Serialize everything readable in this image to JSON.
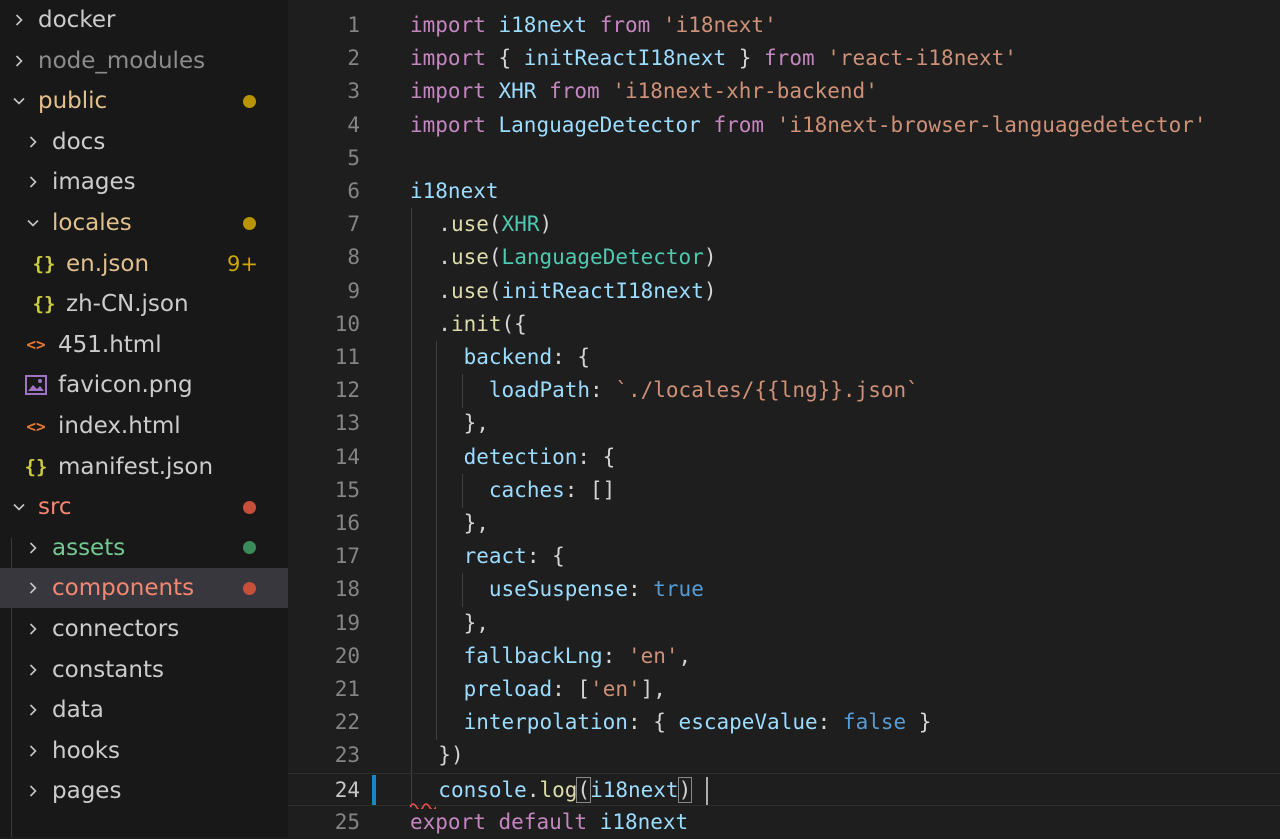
{
  "sidebar": {
    "items": [
      {
        "label": "docker",
        "kind": "folder",
        "expanded": false,
        "depth": 0,
        "color": "#cccccc"
      },
      {
        "label": "node_modules",
        "kind": "folder",
        "expanded": false,
        "depth": 0,
        "color": "#8c8c8c"
      },
      {
        "label": "public",
        "kind": "folder",
        "expanded": true,
        "depth": 0,
        "color": "#e2c08d",
        "dot": "#b89500"
      },
      {
        "label": "docs",
        "kind": "folder",
        "expanded": false,
        "depth": 1,
        "color": "#cccccc"
      },
      {
        "label": "images",
        "kind": "folder",
        "expanded": false,
        "depth": 1,
        "color": "#cccccc"
      },
      {
        "label": "locales",
        "kind": "folder",
        "expanded": true,
        "depth": 1,
        "color": "#e2c08d",
        "dot": "#b89500"
      },
      {
        "label": "en.json",
        "kind": "json",
        "depth": 2,
        "color": "#e2c08d",
        "badge": "9+",
        "badge_color": "#cca700"
      },
      {
        "label": "zh-CN.json",
        "kind": "json",
        "depth": 2,
        "color": "#cccccc"
      },
      {
        "label": "451.html",
        "kind": "html",
        "depth": 1,
        "color": "#cccccc"
      },
      {
        "label": "favicon.png",
        "kind": "image",
        "depth": 1,
        "color": "#cccccc"
      },
      {
        "label": "index.html",
        "kind": "html",
        "depth": 1,
        "color": "#cccccc"
      },
      {
        "label": "manifest.json",
        "kind": "json",
        "depth": 1,
        "color": "#cccccc"
      },
      {
        "label": "src",
        "kind": "folder",
        "expanded": true,
        "depth": 0,
        "color": "#f48771",
        "dot": "#c74e39"
      },
      {
        "label": "assets",
        "kind": "folder",
        "expanded": false,
        "depth": 1,
        "color": "#73c991",
        "dot": "#3a8a5a"
      },
      {
        "label": "components",
        "kind": "folder",
        "expanded": false,
        "depth": 1,
        "color": "#f48771",
        "dot": "#c74e39",
        "selected": true
      },
      {
        "label": "connectors",
        "kind": "folder",
        "expanded": false,
        "depth": 1,
        "color": "#cccccc"
      },
      {
        "label": "constants",
        "kind": "folder",
        "expanded": false,
        "depth": 1,
        "color": "#cccccc"
      },
      {
        "label": "data",
        "kind": "folder",
        "expanded": false,
        "depth": 1,
        "color": "#cccccc"
      },
      {
        "label": "hooks",
        "kind": "folder",
        "expanded": false,
        "depth": 1,
        "color": "#cccccc"
      },
      {
        "label": "pages",
        "kind": "folder",
        "expanded": false,
        "depth": 1,
        "color": "#cccccc"
      }
    ]
  },
  "editor": {
    "active_line": 24,
    "lines": [
      {
        "n": "1",
        "indent": 0,
        "tokens": [
          [
            "kw",
            "import"
          ],
          [
            "pun",
            " "
          ],
          [
            "id",
            "i18next"
          ],
          [
            "pun",
            " "
          ],
          [
            "kw",
            "from"
          ],
          [
            "pun",
            " "
          ],
          [
            "str",
            "'i18next'"
          ]
        ]
      },
      {
        "n": "2",
        "indent": 0,
        "tokens": [
          [
            "kw",
            "import"
          ],
          [
            "pun",
            " { "
          ],
          [
            "id",
            "initReactI18next"
          ],
          [
            "pun",
            " } "
          ],
          [
            "kw",
            "from"
          ],
          [
            "pun",
            " "
          ],
          [
            "str",
            "'react-i18next'"
          ]
        ]
      },
      {
        "n": "3",
        "indent": 0,
        "tokens": [
          [
            "kw",
            "import"
          ],
          [
            "pun",
            " "
          ],
          [
            "id",
            "XHR"
          ],
          [
            "pun",
            " "
          ],
          [
            "kw",
            "from"
          ],
          [
            "pun",
            " "
          ],
          [
            "str",
            "'i18next-xhr-backend'"
          ]
        ]
      },
      {
        "n": "4",
        "indent": 0,
        "tokens": [
          [
            "kw",
            "import"
          ],
          [
            "pun",
            " "
          ],
          [
            "id",
            "LanguageDetector"
          ],
          [
            "pun",
            " "
          ],
          [
            "kw",
            "from"
          ],
          [
            "pun",
            " "
          ],
          [
            "str",
            "'i18next-browser-languagedetector'"
          ]
        ]
      },
      {
        "n": "5",
        "indent": 0,
        "tokens": []
      },
      {
        "n": "6",
        "indent": 0,
        "tokens": [
          [
            "id",
            "i18next"
          ]
        ]
      },
      {
        "n": "7",
        "indent": 1,
        "tokens": [
          [
            "pun",
            "."
          ],
          [
            "fn",
            "use"
          ],
          [
            "pun",
            "("
          ],
          [
            "cls",
            "XHR"
          ],
          [
            "pun",
            ")"
          ]
        ]
      },
      {
        "n": "8",
        "indent": 1,
        "tokens": [
          [
            "pun",
            "."
          ],
          [
            "fn",
            "use"
          ],
          [
            "pun",
            "("
          ],
          [
            "cls",
            "LanguageDetector"
          ],
          [
            "pun",
            ")"
          ]
        ]
      },
      {
        "n": "9",
        "indent": 1,
        "tokens": [
          [
            "pun",
            "."
          ],
          [
            "fn",
            "use"
          ],
          [
            "pun",
            "("
          ],
          [
            "id",
            "initReactI18next"
          ],
          [
            "pun",
            ")"
          ]
        ]
      },
      {
        "n": "10",
        "indent": 1,
        "tokens": [
          [
            "pun",
            "."
          ],
          [
            "fn",
            "init"
          ],
          [
            "pun",
            "({"
          ]
        ]
      },
      {
        "n": "11",
        "indent": 2,
        "tokens": [
          [
            "id",
            "backend"
          ],
          [
            "pun",
            ": {"
          ]
        ]
      },
      {
        "n": "12",
        "indent": 3,
        "tokens": [
          [
            "id",
            "loadPath"
          ],
          [
            "pun",
            ": "
          ],
          [
            "str",
            "`./locales/{{lng}}.json`"
          ]
        ]
      },
      {
        "n": "13",
        "indent": 2,
        "tokens": [
          [
            "pun",
            "},"
          ]
        ]
      },
      {
        "n": "14",
        "indent": 2,
        "tokens": [
          [
            "id",
            "detection"
          ],
          [
            "pun",
            ": {"
          ]
        ]
      },
      {
        "n": "15",
        "indent": 3,
        "tokens": [
          [
            "id",
            "caches"
          ],
          [
            "pun",
            ": []"
          ]
        ]
      },
      {
        "n": "16",
        "indent": 2,
        "tokens": [
          [
            "pun",
            "},"
          ]
        ]
      },
      {
        "n": "17",
        "indent": 2,
        "tokens": [
          [
            "id",
            "react"
          ],
          [
            "pun",
            ": {"
          ]
        ]
      },
      {
        "n": "18",
        "indent": 3,
        "tokens": [
          [
            "id",
            "useSuspense"
          ],
          [
            "pun",
            ": "
          ],
          [
            "kw2",
            "true"
          ]
        ]
      },
      {
        "n": "19",
        "indent": 2,
        "tokens": [
          [
            "pun",
            "},"
          ]
        ]
      },
      {
        "n": "20",
        "indent": 2,
        "tokens": [
          [
            "id",
            "fallbackLng"
          ],
          [
            "pun",
            ": "
          ],
          [
            "str",
            "'en'"
          ],
          [
            "pun",
            ","
          ]
        ]
      },
      {
        "n": "21",
        "indent": 2,
        "tokens": [
          [
            "id",
            "preload"
          ],
          [
            "pun",
            ": ["
          ],
          [
            "str",
            "'en'"
          ],
          [
            "pun",
            "],"
          ]
        ]
      },
      {
        "n": "22",
        "indent": 2,
        "tokens": [
          [
            "id",
            "interpolation"
          ],
          [
            "pun",
            ": { "
          ],
          [
            "id",
            "escapeValue"
          ],
          [
            "pun",
            ": "
          ],
          [
            "kw2",
            "false"
          ],
          [
            "pun",
            " }"
          ]
        ]
      },
      {
        "n": "23",
        "indent": 1,
        "tokens": [
          [
            "pun",
            "})"
          ]
        ]
      },
      {
        "n": "24",
        "indent": 1,
        "tokens": [
          [
            "id",
            "console"
          ],
          [
            "pun",
            "."
          ],
          [
            "fn",
            "log"
          ],
          [
            "bm",
            "("
          ],
          [
            "id",
            "i18next"
          ],
          [
            "bm",
            ")"
          ]
        ]
      },
      {
        "n": "25",
        "indent": 0,
        "tokens": [
          [
            "kw",
            "export"
          ],
          [
            "pun",
            " "
          ],
          [
            "kw",
            "default"
          ],
          [
            "pun",
            " "
          ],
          [
            "id",
            "i18next"
          ]
        ]
      }
    ]
  }
}
